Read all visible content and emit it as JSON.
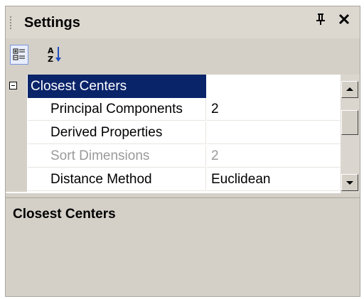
{
  "window": {
    "title": "Settings"
  },
  "icons": {
    "pin": "pin-icon",
    "close": "close-icon",
    "categorized": "categorized-view-icon",
    "alphabetical": "sort-alphabetical-icon",
    "scroll_up": "scroll-up-icon",
    "scroll_down": "scroll-down-icon"
  },
  "glyphs": {
    "pin": "I",
    "close": "✕"
  },
  "grid": {
    "category": {
      "label": "Closest Centers",
      "expanded": true
    },
    "properties": [
      {
        "name": "Principal Components",
        "value": "2",
        "enabled": true
      },
      {
        "name": "Derived Properties",
        "value": "",
        "enabled": true
      },
      {
        "name": "Sort Dimensions",
        "value": "2",
        "enabled": false
      },
      {
        "name": "Distance Method",
        "value": "Euclidean",
        "enabled": true
      }
    ]
  },
  "description": {
    "title": "Closest Centers"
  },
  "colors": {
    "selection": "#0a246a",
    "panel": "#d4d0c8",
    "disabled_text": "#9a9a9a"
  }
}
